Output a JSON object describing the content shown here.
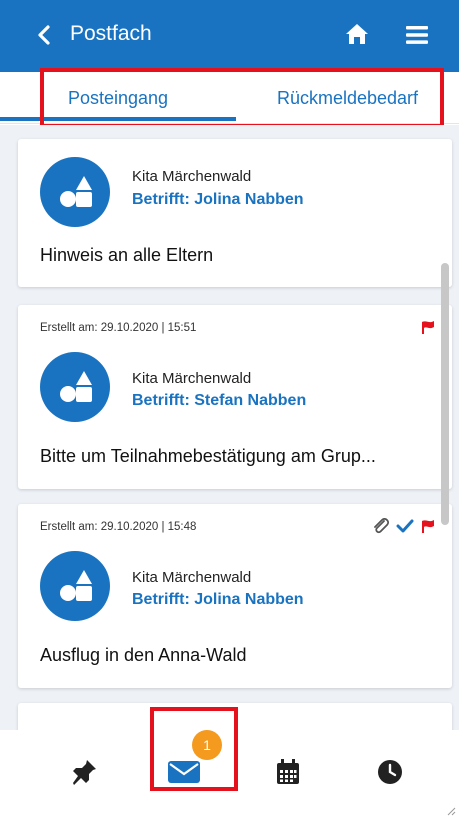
{
  "header": {
    "title": "Postfach",
    "back_icon": "chevron-left-icon",
    "home_icon": "home-icon",
    "menu_icon": "menu-icon",
    "color": "#1a73c0"
  },
  "tabs": [
    {
      "label": "Posteingang",
      "active": true
    },
    {
      "label": "Rückmeldebedarf",
      "active": false
    }
  ],
  "messages": [
    {
      "meta": "",
      "sender": "Kita Märchenwald",
      "subject_ref": "Betrifft: Jolina Nabben",
      "text": "Hinweis an alle Eltern",
      "icons": []
    },
    {
      "meta": "Erstellt am: 29.10.2020 | 15:51",
      "sender": "Kita Märchenwald",
      "subject_ref": "Betrifft: Stefan Nabben",
      "text": "Bitte um Teilnahmebestätigung am Grup...",
      "icons": [
        "flag-icon"
      ]
    },
    {
      "meta": "Erstellt am: 29.10.2020 | 15:48",
      "sender": "Kita Märchenwald",
      "subject_ref": "Betrifft: Jolina Nabben",
      "text": "Ausflug in den Anna-Wald",
      "icons": [
        "paperclip-icon",
        "checkmark-icon",
        "flag-icon"
      ]
    }
  ],
  "bottom_nav": {
    "items": [
      "pin-icon",
      "mail-icon",
      "calendar-icon",
      "clock-icon"
    ],
    "active": "mail-icon",
    "badge": "1",
    "badge_color": "#f39a1f"
  },
  "colors": {
    "primary": "#1a73c0",
    "flag": "#e5121d",
    "highlight": "#e5121d",
    "background": "#eef2f7"
  }
}
